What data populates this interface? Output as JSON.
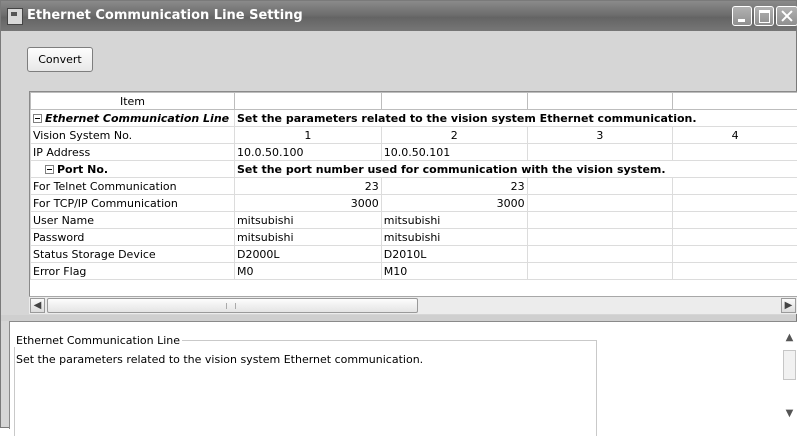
{
  "window": {
    "title": "Ethernet Communication Line Setting"
  },
  "toolbar": {
    "convert_label": "Convert"
  },
  "grid": {
    "header_item": "Item",
    "rows": [
      {
        "label": "Ethernet Communication Line",
        "type": "section",
        "desc": "Set the parameters related to the vision system Ethernet communication."
      },
      {
        "label": "Vision System No.",
        "type": "row",
        "values": [
          "1",
          "2",
          "3",
          "4"
        ]
      },
      {
        "label": "IP Address",
        "type": "row",
        "values": [
          "10.0.50.100",
          "10.0.50.101",
          "",
          ""
        ]
      },
      {
        "label": "Port No.",
        "type": "subsection",
        "desc": "Set the port number used for communication with the vision system."
      },
      {
        "label": "For Telnet Communication",
        "type": "row",
        "values": [
          "23",
          "23",
          "",
          ""
        ]
      },
      {
        "label": "For TCP/IP Communication",
        "type": "row",
        "values": [
          "3000",
          "3000",
          "",
          ""
        ]
      },
      {
        "label": "User Name",
        "type": "row",
        "values": [
          "mitsubishi",
          "mitsubishi",
          "",
          ""
        ]
      },
      {
        "label": "Password",
        "type": "row",
        "values": [
          "mitsubishi",
          "mitsubishi",
          "",
          ""
        ]
      },
      {
        "label": "Status Storage Device",
        "type": "row",
        "values": [
          "D2000L",
          "D2010L",
          "",
          ""
        ]
      },
      {
        "label": "Error Flag",
        "type": "row",
        "values": [
          "M0",
          "M10",
          "",
          ""
        ]
      }
    ]
  },
  "description": {
    "title": "Ethernet Communication Line",
    "text": "Set the parameters related to the vision system Ethernet communication."
  },
  "icons": {
    "app": "window-app-icon",
    "minimize": "minimize-icon",
    "maximize": "maximize-icon",
    "close": "close-icon",
    "collapse": "minus-box-icon",
    "scroll_left": "arrow-left-icon",
    "scroll_right": "arrow-right-icon",
    "scroll_up": "arrow-up-icon",
    "scroll_down": "arrow-down-icon"
  }
}
